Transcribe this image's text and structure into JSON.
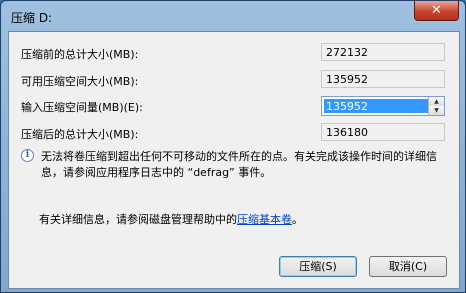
{
  "window": {
    "title": "压缩 D:",
    "close_glyph": "✕"
  },
  "rows": [
    {
      "label": "压缩前的总计大小(MB):",
      "value": "272132"
    },
    {
      "label": "可用压缩空间大小(MB):",
      "value": "135952"
    },
    {
      "label": "输入压缩空间量(MB)(E):",
      "value": "135952"
    },
    {
      "label": "压缩后的总计大小(MB):",
      "value": "136180"
    }
  ],
  "info": {
    "icon": "info-icon",
    "text": "无法将卷压缩到超出任何不可移动的文件所在的点。有关完成该操作时间的详细信息，请参阅应用程序日志中的 “defrag” 事件。"
  },
  "detail": {
    "prefix": "有关详细信息，请参阅磁盘管理帮助中的",
    "link": "压缩基本卷",
    "suffix": "。"
  },
  "buttons": {
    "shrink": "压缩(S)",
    "cancel": "取消(C)"
  },
  "colors": {
    "selection": "#3399ff",
    "link": "#0044cc"
  }
}
